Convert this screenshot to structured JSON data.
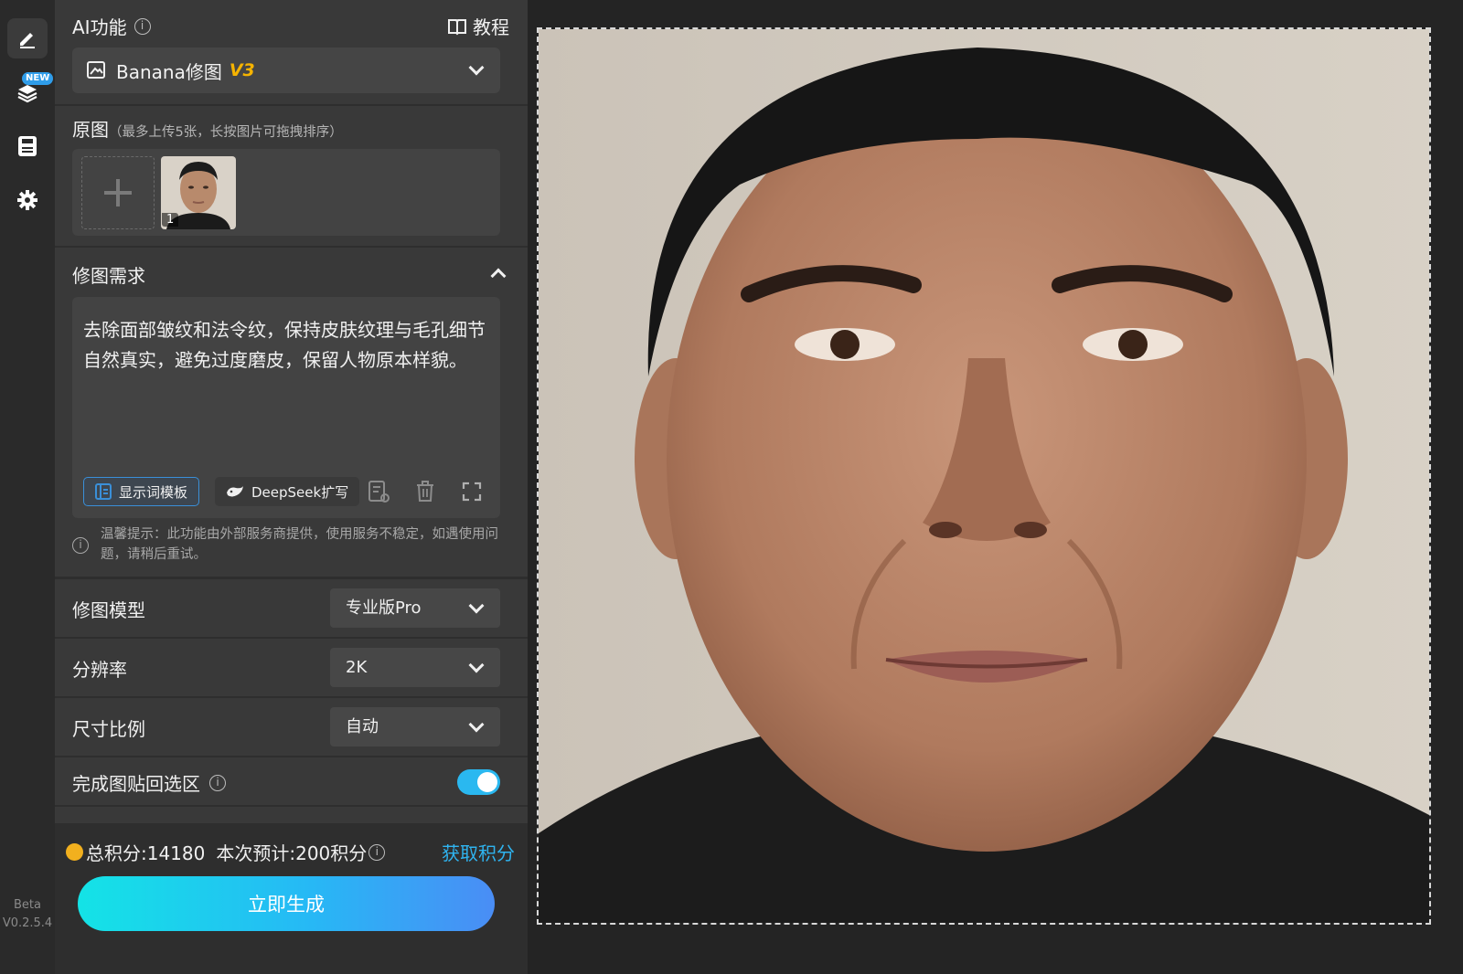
{
  "rail": {
    "version_channel": "Beta",
    "version_number": "V0.2.5.4",
    "new_badge": "NEW"
  },
  "header": {
    "title": "AI功能",
    "tutorial": "教程"
  },
  "function_select": {
    "name": "Banana修图",
    "version": "V3"
  },
  "upload": {
    "title": "原图",
    "hint": "（最多上传5张，长按图片可拖拽排序）",
    "thumb_index": "1"
  },
  "prompt": {
    "title": "修图需求",
    "text": "去除面部皱纹和法令纹，保持皮肤纹理与毛孔细节自然真实，避免过度磨皮，保留人物原本样貌。",
    "template_button": "显示词模板",
    "deepseek_button": "DeepSeek扩写"
  },
  "notice": "温馨提示：此功能由外部服务商提供，使用服务不稳定，如遇使用问题，请稍后重试。",
  "settings": [
    {
      "label": "修图模型",
      "value": "专业版Pro"
    },
    {
      "label": "分辨率",
      "value": "2K"
    },
    {
      "label": "尺寸比例",
      "value": "自动"
    }
  ],
  "paste_back": {
    "label": "完成图贴回选区",
    "enabled": true
  },
  "footer": {
    "total_points": "总积分:14180",
    "estimate": "本次预计:200积分",
    "get_points": "获取积分",
    "generate": "立即生成"
  },
  "colors": {
    "accent": "#2ab8f0",
    "version_tag": "#f5b300",
    "coin": "#f2b01e"
  }
}
